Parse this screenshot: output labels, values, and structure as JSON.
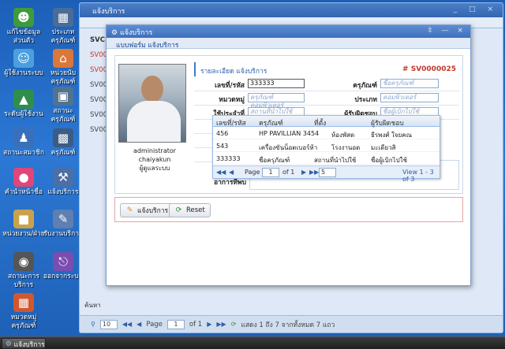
{
  "desktop_icons": [
    {
      "label": "แก้ไขข้อมูลส่วนตัว",
      "icon": "user-edit-icon",
      "color": "#3f9a3a"
    },
    {
      "label": "ประเภทครุภัณฑ์",
      "icon": "server-icon",
      "color": "#4a6c96"
    },
    {
      "label": "ผู้ใช้งานระบบ",
      "icon": "users-icon",
      "color": "#4aa0de"
    },
    {
      "label": "หน่วยนับครุภัณฑ์",
      "icon": "home-icon",
      "color": "#d9783a"
    },
    {
      "label": "ระดับผู้ใช้งาน",
      "icon": "level-icon",
      "color": "#2f8f4a"
    },
    {
      "label": "สถานะครุภัณฑ์",
      "icon": "monitor-icon",
      "color": "#53728f"
    },
    {
      "label": "สถานะสมาชิก",
      "icon": "group-icon",
      "color": "#3a6fba"
    },
    {
      "label": "ครุภัณฑ์",
      "icon": "computer-icon",
      "color": "#3c5c84"
    },
    {
      "label": "คำนำหน้าชื่อ",
      "icon": "tag-icon",
      "color": "#e0467a"
    },
    {
      "label": "แจ้งบริการ",
      "icon": "wrench-icon",
      "color": "#4b6fa6"
    },
    {
      "label": "หน่วยงาน/ฝ่าย",
      "icon": "building-icon",
      "color": "#c9a24a"
    },
    {
      "label": "รับงานบริการ",
      "icon": "clipboard-icon",
      "color": "#5e7fb0"
    },
    {
      "label": "สถานะการบริการ",
      "icon": "traffic-light-icon",
      "color": "#555555"
    },
    {
      "label": "ออกจากระบบ",
      "icon": "logout-icon",
      "color": "#7a4db0"
    },
    {
      "label": "หมวดหมู่ครุภัณฑ์",
      "icon": "package-icon",
      "color": "#d2572e"
    }
  ],
  "bg_window": {
    "title": "แจ้งบริการ",
    "list_header": "SVC",
    "rows": [
      "SV00",
      "SV00",
      "SV00",
      "SV00",
      "SV00",
      "SV00"
    ],
    "search_label": "ค้นหา",
    "pager": {
      "page_size": "10",
      "page_label": "Page",
      "page_value": "1",
      "of_label": "of 1",
      "status": "แสดง 1 ถึง 7 จากทั้งหมด 7 แถว"
    }
  },
  "dialog": {
    "title": "แจ้งบริการ",
    "subtitle": "แบบฟอร์ม แจ้งบริการ",
    "section_title": "รายละเอียด แจ้งบริการ",
    "job_id": "# SV0000025",
    "user_name": "administrator chaiyakun",
    "user_role": "ผู้ดูแลระบบ",
    "fields": {
      "code_label": "เลขที่/รหัส",
      "code_value": "333333",
      "asset_label": "ครุภัณฑ์",
      "asset_placeholder": "ชื่อครุภัณฑ์",
      "category_label": "หมวดหมู่",
      "category_placeholder": "ครุภัณฑ์คอมพิวเตอร์",
      "type_label": "ประเภท",
      "type_placeholder": "คอมพิวเตอร์",
      "location_label": "ใช้ประจำที่",
      "location_placeholder": "สถานที่นำไปใช้",
      "owner_label": "ผู้รับผิดชอบ",
      "owner_placeholder": "ชื่อผู้เบิกไปใช้",
      "date_label": "วันที่",
      "status_label": "สถา",
      "note_label": "แจ",
      "symptom_label_1": "ร",
      "symptom_label_2": "ลักษ",
      "symptom_label_3": "อาการที่พบ"
    },
    "dropdown": {
      "headers": [
        "เลขที่/รหัส",
        "ครุภัณฑ์",
        "ที่ตั้ง",
        "ผู้รับผิดชอบ"
      ],
      "rows": [
        [
          "456",
          "HP PAVILLIAN 3454",
          "ห้องพัสด",
          "ธีรพงศ์ ใจยคณ"
        ],
        [
          "543",
          "เครื่องขันน็อตเบอร์ห้า",
          "โรงงานอด",
          "มะเดียวสิ"
        ],
        [
          "333333",
          "ชื่อครุภัณฑ์",
          "สถานที่นำไปใช้",
          "ชื่อผู้เบิกไปใช้"
        ]
      ],
      "pager_page": "Page",
      "pager_value": "1",
      "pager_of": "of 1",
      "pager_size": "5",
      "pager_status": "View 1 - 3 of 3"
    },
    "buttons": {
      "submit": "แจ้งบริการ",
      "reset": "Reset"
    }
  },
  "taskbar": {
    "active_task": "แจ้งบริการ"
  }
}
